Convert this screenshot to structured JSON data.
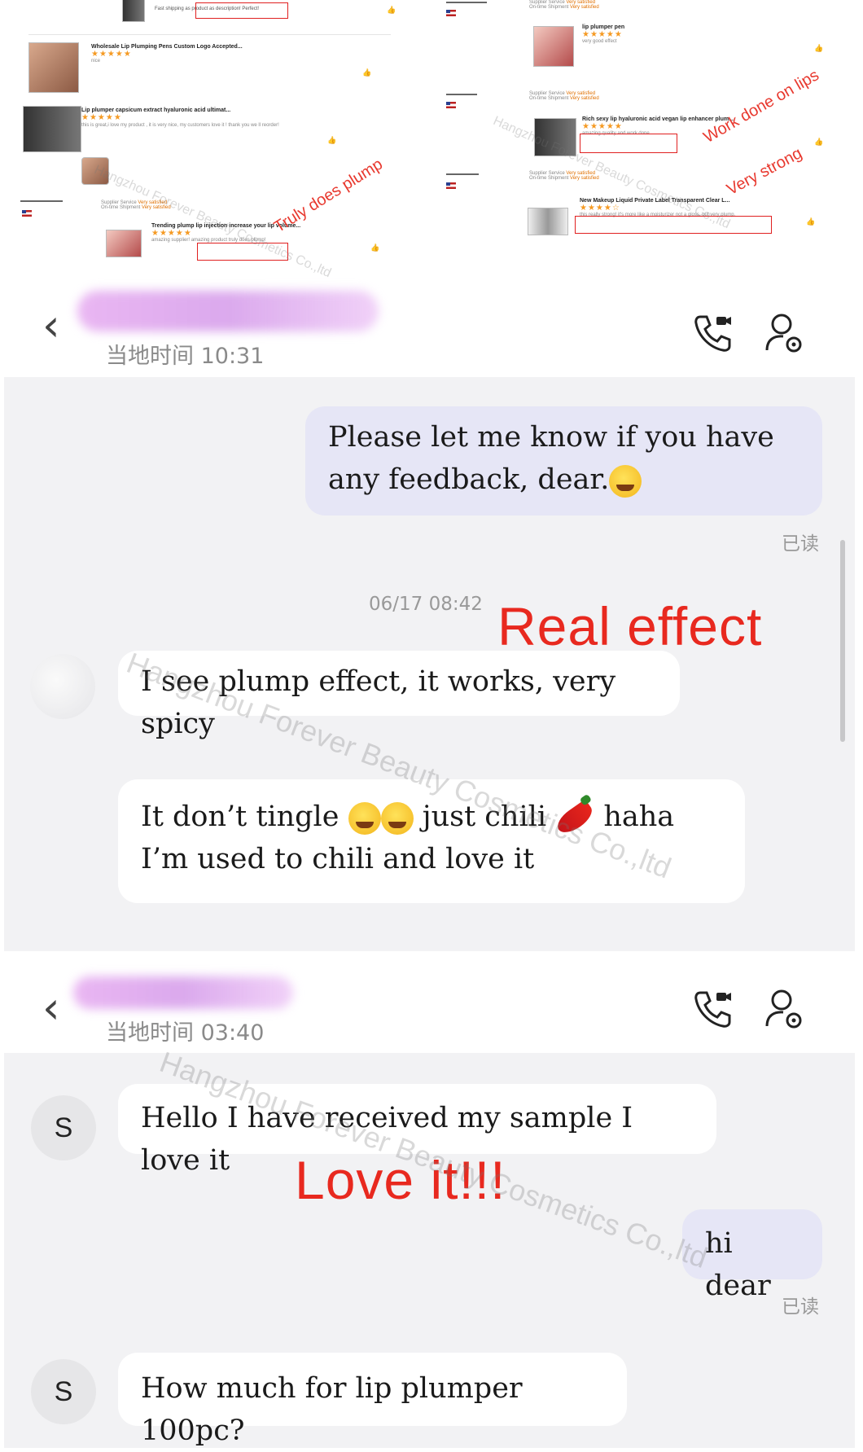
{
  "reviews": {
    "left": [
      {
        "title": "",
        "text": "Fast shipping as product as description! Perfect!"
      },
      {
        "title": "Wholesale Lip Plumping Pens Custom Logo Accepted...",
        "text": "nice"
      },
      {
        "title": "Lip plumper capsicum extract hyaluronic acid ultimat...",
        "text": "this is great,i love my product , it is very nice, my customers love it ! thank you we ll reorder!"
      },
      {
        "title": "Trending plump lip injection increase your lip volume...",
        "text": "amazing supplier! amazing product truly does plump!"
      }
    ],
    "right": [
      {
        "title": "lip plumper pen",
        "text": "very good effect"
      },
      {
        "title": "Rich sexy lip hyaluronic acid vegan lip enhancer plum...",
        "text": "amazing quality and work done"
      },
      {
        "title": "New Makeup Liquid Private Label Transparent Clear L...",
        "text": "this really strong! it's more like a moisturizer not a gloss. but very plump."
      }
    ],
    "stars": "★★★★★",
    "stars4": "★★★★☆",
    "service_label": "Supplier Service",
    "shipment_label": "On-time Shipment",
    "very_satisfied": "Very satisfied",
    "annotations": {
      "truly_does_plump": "Truly does plump",
      "work_done_on_lips": "Work done on lips",
      "very_strong": "Very strong"
    }
  },
  "chat1": {
    "local_time": "当地时间 10:31",
    "messages": {
      "m1": "Please let me know if you have any feedback, dear.",
      "m1_read": "已读",
      "timestamp": "06/17 08:42",
      "m2": "I see plump effect, it works, very spicy",
      "m3_a": "It don’t tingle",
      "m3_b": "just chili",
      "m3_c": "haha I’m used to chili and love it"
    },
    "label": "Real effect"
  },
  "chat2": {
    "local_time": "当地时间 03:40",
    "avatar_letter": "S",
    "messages": {
      "m1": "Hello I have received my sample I love it",
      "m2": "hi dear",
      "m2_read": "已读",
      "m3": "How much for lip plumper 100pc?"
    },
    "label": "Love it!!!"
  },
  "watermark": "Hangzhou Forever Beauty Cosmetics Co.,ltd",
  "icons": {
    "back": "chevron-left-icon",
    "call": "video-call-icon",
    "profile": "user-settings-icon"
  },
  "colors": {
    "annotation_red": "#e8291f",
    "bubble_out": "#e6e6f6",
    "bubble_in": "#ffffff",
    "chat_bg": "#f2f2f4",
    "star": "#f59a23"
  }
}
